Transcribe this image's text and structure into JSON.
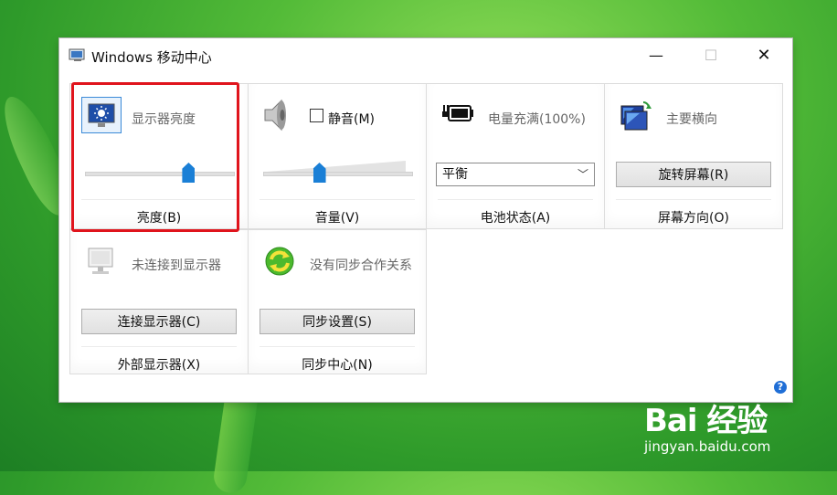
{
  "window": {
    "title": "Windows 移动中心"
  },
  "brightness": {
    "heading": "显示器亮度",
    "level": 0.7,
    "footer": "亮度(B)"
  },
  "volume": {
    "mute_label": "静音(M)",
    "level": 0.38,
    "footer": "音量(V)"
  },
  "battery": {
    "heading": "电量充满(100%)",
    "plan": "平衡",
    "footer": "电池状态(A)"
  },
  "orientation": {
    "heading": "主要横向",
    "button": "旋转屏幕(R)",
    "footer": "屏幕方向(O)"
  },
  "display": {
    "heading": "未连接到显示器",
    "button": "连接显示器(C)",
    "footer": "外部显示器(X)"
  },
  "sync": {
    "heading": "没有同步合作关系",
    "button": "同步设置(S)",
    "footer": "同步中心(N)"
  },
  "help": {
    "label": "?"
  },
  "watermark": {
    "logo": "Bai 经验",
    "url": "jingyan.baidu.com"
  }
}
